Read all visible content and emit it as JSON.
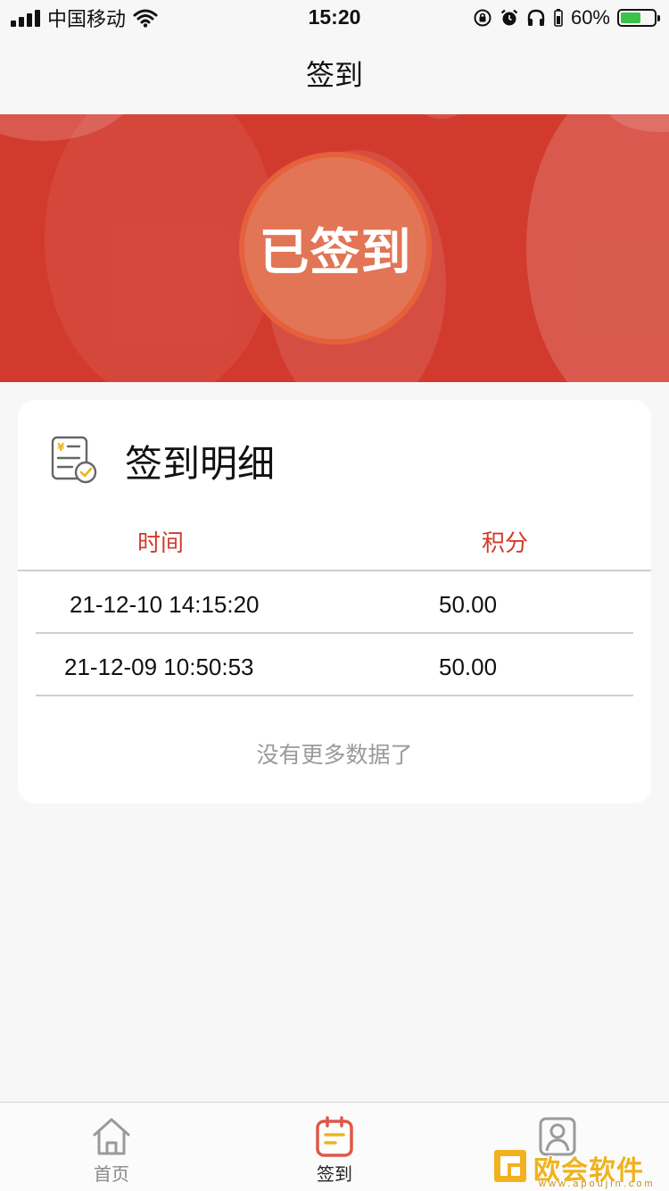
{
  "status_bar": {
    "carrier": "中国移动",
    "time": "15:20",
    "battery_percent": "60%",
    "battery_level": 0.6,
    "icons": [
      "signal-icon",
      "wifi-icon",
      "orientation-lock-icon",
      "alarm-icon",
      "headphones-icon",
      "battery-icon"
    ]
  },
  "nav": {
    "title": "签到"
  },
  "banner": {
    "status_text": "已签到",
    "colors": {
      "background": "#d23a2d",
      "circle": "#e27555",
      "ring": "#e5603b"
    }
  },
  "detail": {
    "title": "签到明细",
    "icon": "document-check-icon",
    "columns": [
      "时间",
      "积分"
    ],
    "rows": [
      {
        "time": "21-12-10 14:15:20",
        "points": "50.00"
      },
      {
        "time": "21-12-09 10:50:53",
        "points": "50.00"
      }
    ],
    "no_more": "没有更多数据了"
  },
  "tabs": [
    {
      "label": "首页",
      "icon": "home-icon",
      "active": false
    },
    {
      "label": "签到",
      "icon": "calendar-icon",
      "active": true
    },
    {
      "label": "",
      "icon": "user-icon",
      "active": false
    }
  ],
  "watermark": {
    "text": "欧会软件园",
    "sub": "www.apoujin.com"
  },
  "accent_color": "#d23a2d"
}
